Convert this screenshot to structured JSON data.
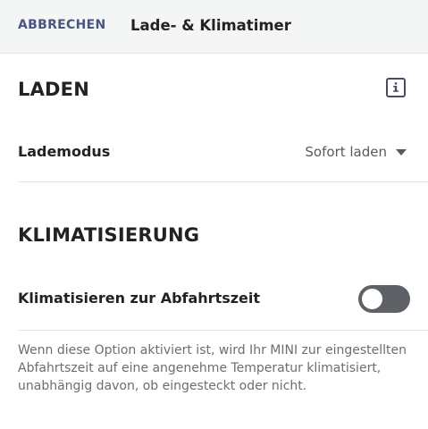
{
  "header": {
    "cancel_label": "ABBRECHEN",
    "title": "Lade- & Klimatimer"
  },
  "laden": {
    "title": "LADEN",
    "info_icon": "info-icon",
    "charge_mode_label": "Lademodus",
    "charge_mode_value": "Sofort laden"
  },
  "klima": {
    "title": "KLIMATISIERUNG",
    "toggle_label": "Klimatisieren zur Abfahrtszeit",
    "toggle_on": false,
    "description": "Wenn diese Option aktiviert ist, wird Ihr MINI zur eingestellten Abfahrtszeit auf eine angenehme Temperatur klimatisiert, unabhängig davon, ob eingesteckt oder nicht."
  },
  "colors": {
    "accent": "#4a5580",
    "toggle_off": "#5e6166",
    "header_bg": "#f4f5f5"
  }
}
